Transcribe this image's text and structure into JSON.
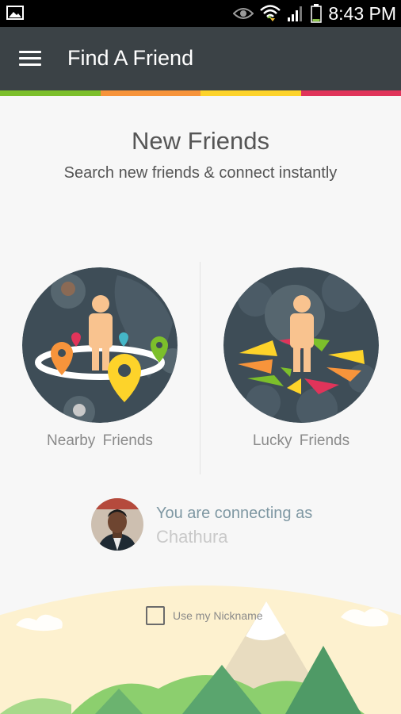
{
  "status_bar": {
    "time": "8:43 PM",
    "icons": [
      "image-icon",
      "eye-icon",
      "wifi-icon",
      "signal-icon",
      "battery-icon"
    ]
  },
  "app_bar": {
    "title": "Find A Friend",
    "menu_icon": "hamburger-menu-icon",
    "background": "#3b4246"
  },
  "accent_stripes": [
    "#7cbf2b",
    "#f7943b",
    "#fdd32a",
    "#e0345a"
  ],
  "main": {
    "title": "New Friends",
    "subtitle": "Search new friends & connect instantly",
    "options": [
      {
        "label": "Nearby  Friends",
        "icon": "nearby-friends-illustration"
      },
      {
        "label": "Lucky  Friends",
        "icon": "lucky-friends-illustration"
      }
    ]
  },
  "connection": {
    "label": "You are connecting as",
    "name": "Chathura",
    "avatar": "user-avatar"
  },
  "nickname": {
    "label": "Use my Nickname",
    "checked": false
  }
}
